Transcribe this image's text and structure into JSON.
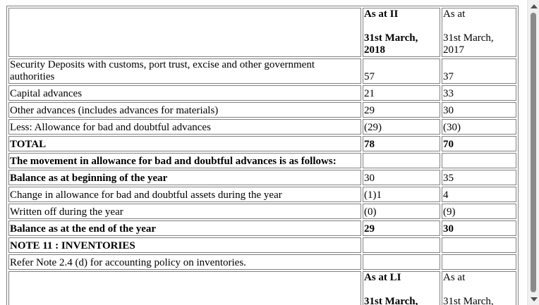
{
  "header": {
    "col1_line1": "As at II",
    "col1_line2": "31st March,",
    "col1_line3": "2018",
    "col2_line1": "As at",
    "col2_line2": "31st March,",
    "col2_line3": "2017"
  },
  "rows": [
    {
      "label_line1": "Security Deposits with customs, port trust, excise and other government",
      "label_line2": "authorities",
      "v2018": "57",
      "v2017": "37"
    },
    {
      "label": "Capital advances",
      "v2018": "21",
      "v2017": "33"
    },
    {
      "label": "Other advances (includes advances for materials)",
      "v2018": "29",
      "v2017": "30"
    },
    {
      "label": "Less: Allowance for bad and doubtful advances",
      "v2018": "(29)",
      "v2017": "(30)"
    },
    {
      "label": "TOTAL",
      "v2018": "78",
      "v2017": "70"
    },
    {
      "label": "The movement in allowance for bad and doubtful advances is as follows:",
      "v2018": "",
      "v2017": ""
    },
    {
      "label": "Balance as at beginning of the year",
      "v2018": "30",
      "v2017": "35"
    },
    {
      "label": "Change in allowance for bad and doubtful assets during the year",
      "v2018": "(1)1",
      "v2017": "4"
    },
    {
      "label": "Written off during the year",
      "v2018": "(0)",
      "v2017": "(9)"
    },
    {
      "label": "Balance as at the end of the year",
      "v2018": "29",
      "v2017": "30"
    },
    {
      "label": "NOTE 11 : INVENTORIES",
      "v2018": "",
      "v2017": ""
    },
    {
      "label": "Refer Note 2.4 (d) for accounting policy on inventories.",
      "v2018": "",
      "v2017": ""
    }
  ],
  "header2": {
    "col1_line1": "As at LI",
    "col1_line2": "31st March,",
    "col2_line1": "As at",
    "col2_line2": "31st March,"
  },
  "scrollbar": {
    "up_icon": "arrow-up-icon",
    "down_icon": "arrow-down-icon"
  }
}
